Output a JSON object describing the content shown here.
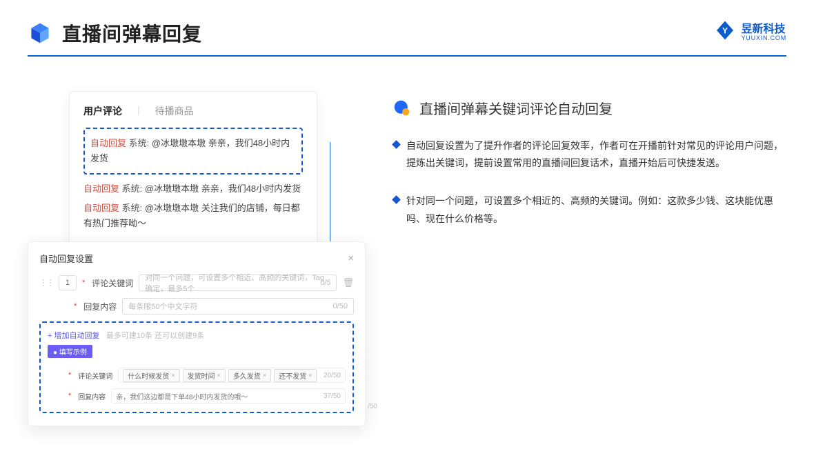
{
  "header": {
    "title": "直播间弹幕回复",
    "brand_name": "昱新科技",
    "brand_sub": "YUUXIN.COM"
  },
  "comments_card": {
    "tab_active": "用户评论",
    "tab_inactive": "待播商品",
    "highlight": {
      "label": "自动回复",
      "sys": "系统:",
      "msg": "@冰墩墩本墩 亲亲，我们48小时内发货"
    },
    "lines": [
      {
        "label": "自动回复",
        "sys": "系统:",
        "msg": "@冰墩墩本墩 亲亲，我们48小时内发货"
      },
      {
        "label": "自动回复",
        "sys": "系统:",
        "msg": "@冰墩墩本墩 关注我们的店铺，每日都有热门推荐呦～"
      }
    ]
  },
  "settings_card": {
    "title": "自动回复设置",
    "num": "1",
    "keyword_label": "评论关键词",
    "keyword_placeholder": "对同一个问题，可设置多个相近、高频的关键词，Tag确定，最多5个",
    "keyword_counter": "0/5",
    "content_label": "回复内容",
    "content_placeholder": "每条限50个中文字符",
    "content_counter": "0/50",
    "add_link": "+ 增加自动回复",
    "add_hint": "最多可建10条 还可以创建9条",
    "example_badge": "● 填写示例",
    "ex_keyword_label": "评论关键词",
    "ex_tags": [
      "什么时候发货",
      "发货时间",
      "多久发货",
      "还不发货"
    ],
    "ex_keyword_counter": "20/50",
    "ex_content_label": "回复内容",
    "ex_content_value": "亲，我们这边都是下单48小时内发货的哦～",
    "ex_content_counter": "37/50",
    "outside_counter": "/50"
  },
  "right": {
    "section_title": "直播间弹幕关键词评论自动回复",
    "bullets": [
      "自动回复设置为了提升作者的评论回复效率，作者可在开播前针对常见的评论用户问题，提炼出关键词，提前设置常用的直播间回复话术，直播开始后可快捷发送。",
      "针对同一个问题，可设置多个相近的、高频的关键词。例如：这款多少钱、这块能优惠吗、现在什么价格等。"
    ]
  }
}
